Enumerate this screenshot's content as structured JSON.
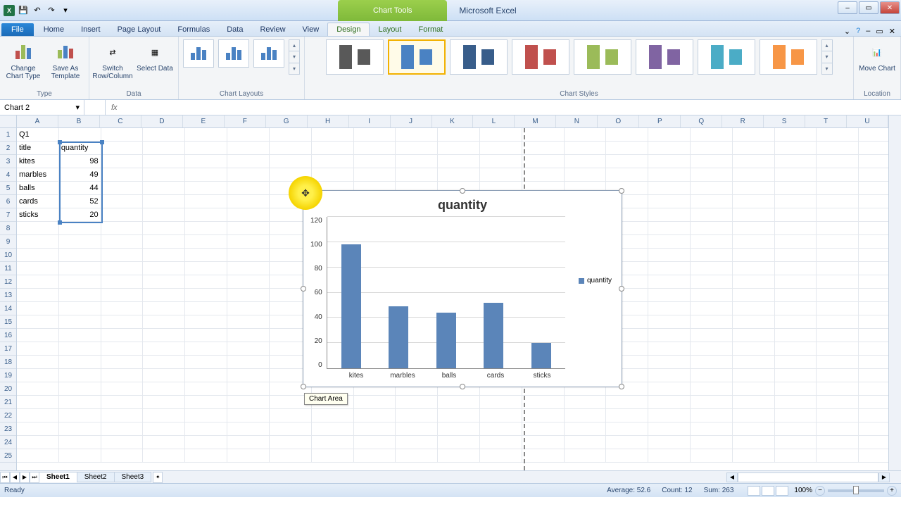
{
  "app": {
    "title": "Microsoft Excel",
    "qat_icons": [
      "save-icon",
      "undo-icon",
      "redo-icon"
    ],
    "win_controls": {
      "min": "–",
      "max": "▭",
      "close": "✕"
    },
    "chart_tools_label": "Chart Tools"
  },
  "tabs": {
    "file": "File",
    "items": [
      "Home",
      "Insert",
      "Page Layout",
      "Formulas",
      "Data",
      "Review",
      "View"
    ],
    "ctx_items": [
      "Design",
      "Layout",
      "Format"
    ],
    "active": "Design"
  },
  "ribbon": {
    "type_group": {
      "label": "Type",
      "change": "Change Chart Type",
      "save": "Save As Template"
    },
    "data_group": {
      "label": "Data",
      "switch": "Switch Row/Column",
      "select": "Select Data"
    },
    "layouts_group": {
      "label": "Chart Layouts"
    },
    "styles_group": {
      "label": "Chart Styles"
    },
    "location_group": {
      "label": "Location",
      "move": "Move Chart"
    }
  },
  "name_box": "Chart 2",
  "fx_label": "fx",
  "columns": [
    "A",
    "B",
    "C",
    "D",
    "E",
    "F",
    "G",
    "H",
    "I",
    "J",
    "K",
    "L",
    "M",
    "N",
    "O",
    "P",
    "Q",
    "R",
    "S",
    "T",
    "U"
  ],
  "data_rows": [
    [
      "Q1",
      ""
    ],
    [
      "title",
      "quantity"
    ],
    [
      "kites",
      "98"
    ],
    [
      "marbles",
      "49"
    ],
    [
      "balls",
      "44"
    ],
    [
      "cards",
      "52"
    ],
    [
      "sticks",
      "20"
    ]
  ],
  "chart_data": {
    "type": "bar",
    "title": "quantity",
    "categories": [
      "kites",
      "marbles",
      "balls",
      "cards",
      "sticks"
    ],
    "values": [
      98,
      49,
      44,
      52,
      20
    ],
    "ylim": [
      0,
      120
    ],
    "yticks": [
      0,
      20,
      40,
      60,
      80,
      100,
      120
    ],
    "legend": "quantity",
    "legend_pos": "right",
    "xlabel": "",
    "ylabel": ""
  },
  "chart_tooltip": "Chart Area",
  "sheets": {
    "items": [
      "Sheet1",
      "Sheet2",
      "Sheet3"
    ],
    "active": 0
  },
  "status": {
    "left": "Ready",
    "avg_label": "Average:",
    "avg": "52.6",
    "count_label": "Count:",
    "count": "12",
    "sum_label": "Sum:",
    "sum": "263",
    "zoom": "100%"
  },
  "style_colors": [
    "#595959",
    "#4a82c3",
    "#385d8a",
    "#c0504d",
    "#9bbb59",
    "#8064a2",
    "#4bacc6",
    "#f79646"
  ]
}
